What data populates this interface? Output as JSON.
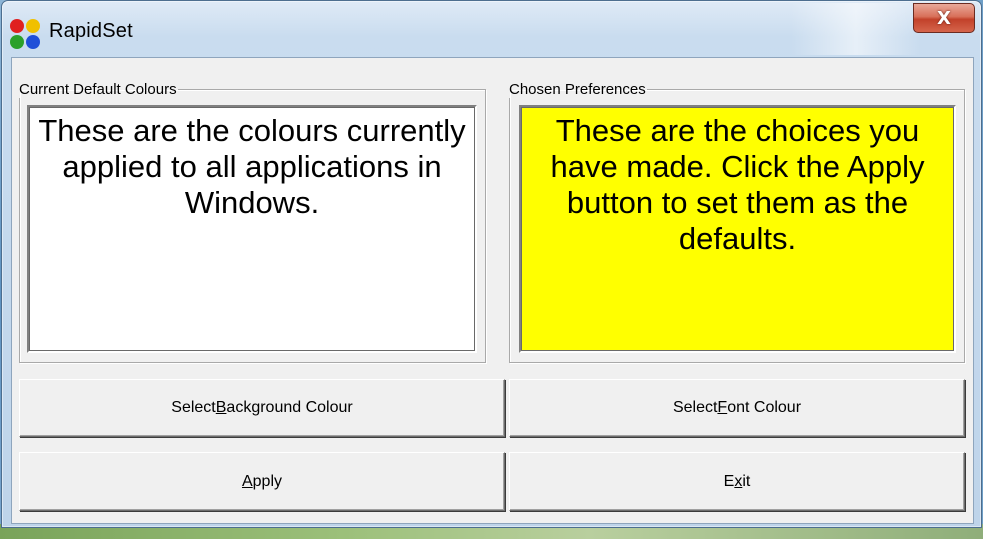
{
  "window": {
    "title": "RapidSet",
    "close_glyph": "X"
  },
  "icons": {
    "app": "rapidset-app-icon",
    "close": "close-icon",
    "app_icon_colors": [
      "#e02020",
      "#f0c000",
      "#2aa02a",
      "#1f4fd8"
    ]
  },
  "current_defaults": {
    "legend": "Current Default Colours",
    "text": "These are the colours currently applied to all applications in Windows.",
    "background": "#ffffff",
    "font_color": "#000000"
  },
  "chosen_preferences": {
    "legend": "Chosen Preferences",
    "text": "These are the choices you have made.  Click the Apply button to set them as the defaults.",
    "background": "#ffff00",
    "font_color": "#000000"
  },
  "buttons": {
    "background": {
      "pre": "Select ",
      "accel": "B",
      "post": "ackground Colour"
    },
    "font": {
      "pre": "Select ",
      "accel": "F",
      "post": "ont Colour"
    },
    "apply": {
      "pre": "",
      "accel": "A",
      "post": "pply"
    },
    "exit": {
      "pre": "E",
      "accel": "x",
      "post": "it"
    }
  }
}
